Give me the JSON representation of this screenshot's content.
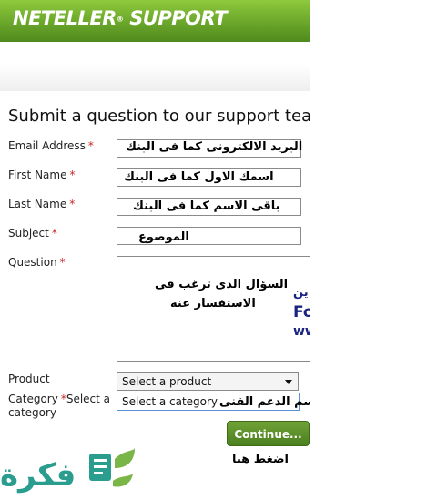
{
  "header": {
    "brand": "NETELLER",
    "brand_suffix": "SUPPORT",
    "reg_mark": "®"
  },
  "form": {
    "title": "Submit a question to our support team",
    "fields": {
      "email": {
        "label": "Email Address",
        "required": "*",
        "annotation": "البريد الالكترونى كما فى البنك"
      },
      "first_name": {
        "label": "First Name",
        "required": "*",
        "annotation": "اسمك الاول كما فى البنك"
      },
      "last_name": {
        "label": "Last Name",
        "required": "*",
        "annotation": "باقى الاسم كما فى البنك"
      },
      "subject": {
        "label": "Subject",
        "required": "*",
        "annotation": "الموضوع"
      },
      "question": {
        "label": "Question",
        "required": "*",
        "annotation_line1": "السؤال الذى ترغب فى",
        "annotation_line2": "الاستفسار عنه",
        "peek_line1": "ين",
        "peek_line2": "Fo",
        "peek_line3": "ww"
      },
      "product": {
        "label": "Product",
        "placeholder": "Select a product"
      },
      "category": {
        "label": "Category",
        "required": "*",
        "label_rest": "Select a",
        "label_line2": "category",
        "placeholder": "Select a category",
        "annotation": "قسم الدعم الفنى"
      }
    },
    "submit": {
      "label": "Continue...",
      "annotation": "اضغط هنا"
    }
  },
  "watermark": {
    "text": "فكرة"
  },
  "colors": {
    "brand_green": "#6aa62a",
    "button_green": "#4c7f1f",
    "required_red": "#cc2222",
    "link_navy": "#1a237e",
    "logo_teal": "#2a9d8f"
  }
}
